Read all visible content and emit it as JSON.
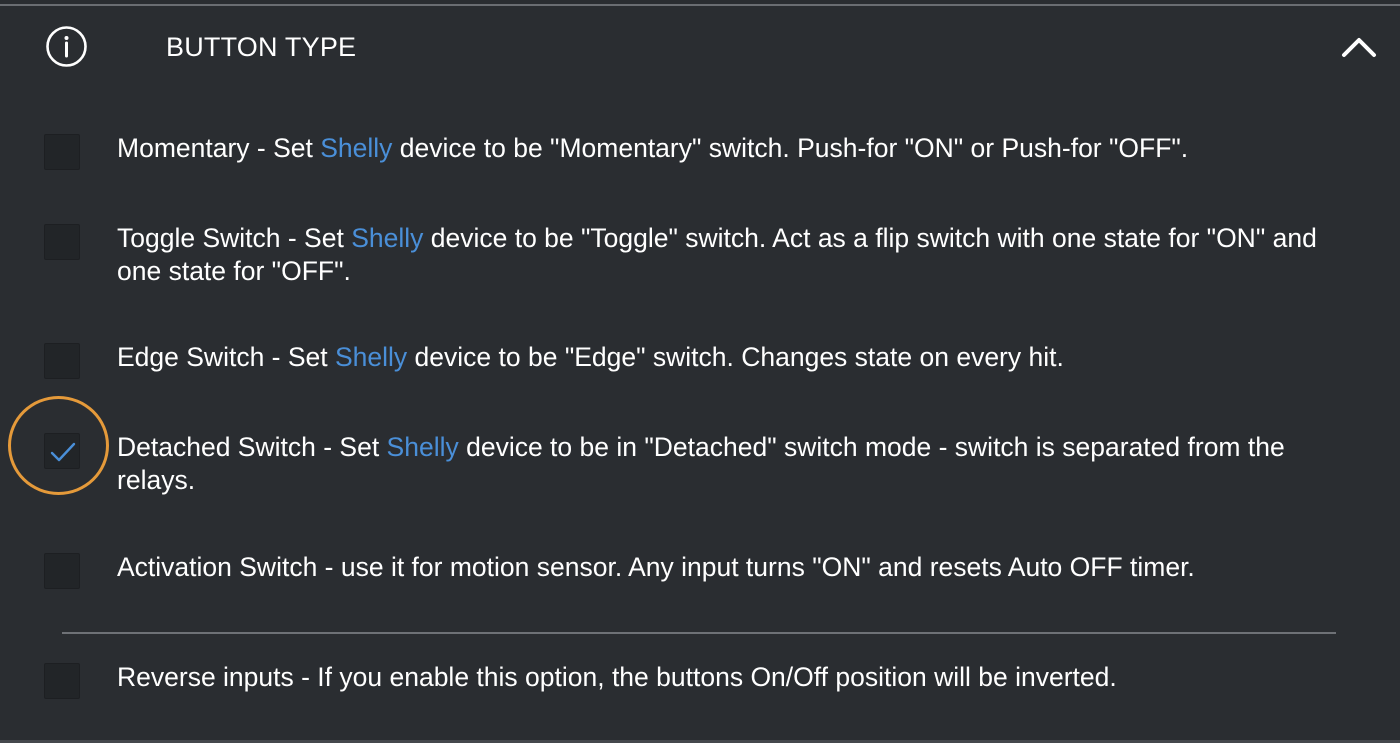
{
  "header": {
    "title": "BUTTON TYPE",
    "info_icon": "info-icon",
    "collapse_icon": "chevron-up-icon"
  },
  "options": [
    {
      "before": "Momentary - Set ",
      "brand": "Shelly",
      "after": " device to be \"Momentary\" switch. Push-for \"ON\" or Push-for \"OFF\".",
      "checked": false
    },
    {
      "before": "Toggle Switch - Set ",
      "brand": "Shelly",
      "after": " device to be \"Toggle\" switch. Act as a flip switch with one state for \"ON\" and one state for \"OFF\".",
      "checked": false
    },
    {
      "before": "Edge Switch - Set ",
      "brand": "Shelly",
      "after": " device to be \"Edge\" switch. Changes state on every hit.",
      "checked": false
    },
    {
      "before": "Detached Switch - Set ",
      "brand": "Shelly",
      "after": " device to be in \"Detached\" switch mode - switch is separated from the relays.",
      "checked": true
    },
    {
      "before": "Activation Switch - use it for motion sensor. Any input turns \"ON\" and resets Auto OFF timer.",
      "brand": "",
      "after": "",
      "checked": false
    }
  ],
  "reverse": {
    "label": "Reverse inputs - If you enable this option, the buttons On/Off position will be inverted.",
    "checked": false
  },
  "colors": {
    "background": "#2a2d31",
    "brand": "#4a8fd8",
    "check": "#4a8fd8",
    "highlight": "#e59a3a"
  }
}
